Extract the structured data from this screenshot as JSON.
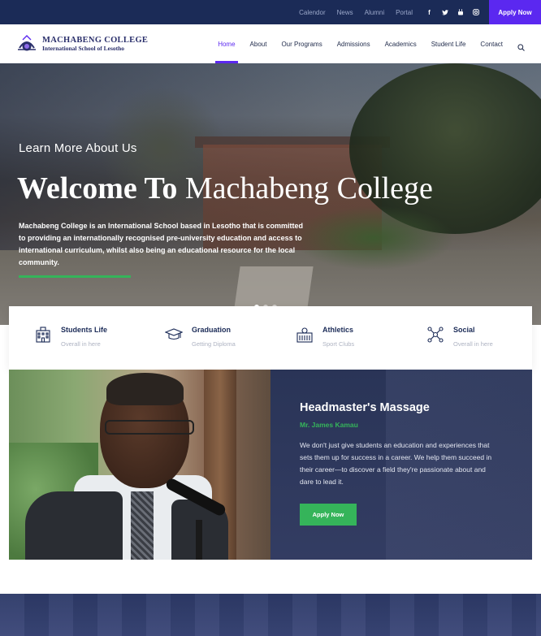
{
  "topbar": {
    "links": [
      "Calendor",
      "News",
      "Alumni",
      "Portal"
    ],
    "social_icons": [
      "facebook-icon",
      "twitter-icon",
      "youtube-icon",
      "instagram-icon"
    ],
    "apply_label": "Apply Now"
  },
  "header": {
    "logo_name": "MACHABENG COLLEGE",
    "logo_sub": "International School of Lesotho",
    "nav": [
      "Home",
      "About",
      "Our Programs",
      "Admissions",
      "Academics",
      "Student Life",
      "Contact"
    ],
    "active_nav": "Home"
  },
  "hero": {
    "subtitle": "Learn More About Us",
    "title_bold": "Welcome To",
    "title_regular": "Machabeng College",
    "description": "Machabeng College is an International School based in Lesotho that is committed to providing an internationally recognised pre-university education and access to international curriculum, whilst also being an educational resource for the local community."
  },
  "features": [
    {
      "icon": "students-building-icon",
      "title": "Students Life",
      "subtitle": "Overall in here"
    },
    {
      "icon": "graduation-cap-icon",
      "title": "Graduation",
      "subtitle": "Getting Diploma"
    },
    {
      "icon": "athletics-building-icon",
      "title": "Athletics",
      "subtitle": "Sport Clubs"
    },
    {
      "icon": "social-network-icon",
      "title": "Social",
      "subtitle": "Overall in here"
    }
  ],
  "headmaster": {
    "title": "Headmaster's Massage",
    "name": "Mr. James Kamau",
    "text": "We don't just give students an education and experiences that sets them up for success in a career. We help them succeed in their career—to discover a field they're passionate about and dare to lead it.",
    "button_label": "Apply Now"
  },
  "colors": {
    "topbar_bg": "#1b2b57",
    "accent_purple": "#5b28f0",
    "accent_green": "#35b45a",
    "panel_navy": "#212c50"
  }
}
